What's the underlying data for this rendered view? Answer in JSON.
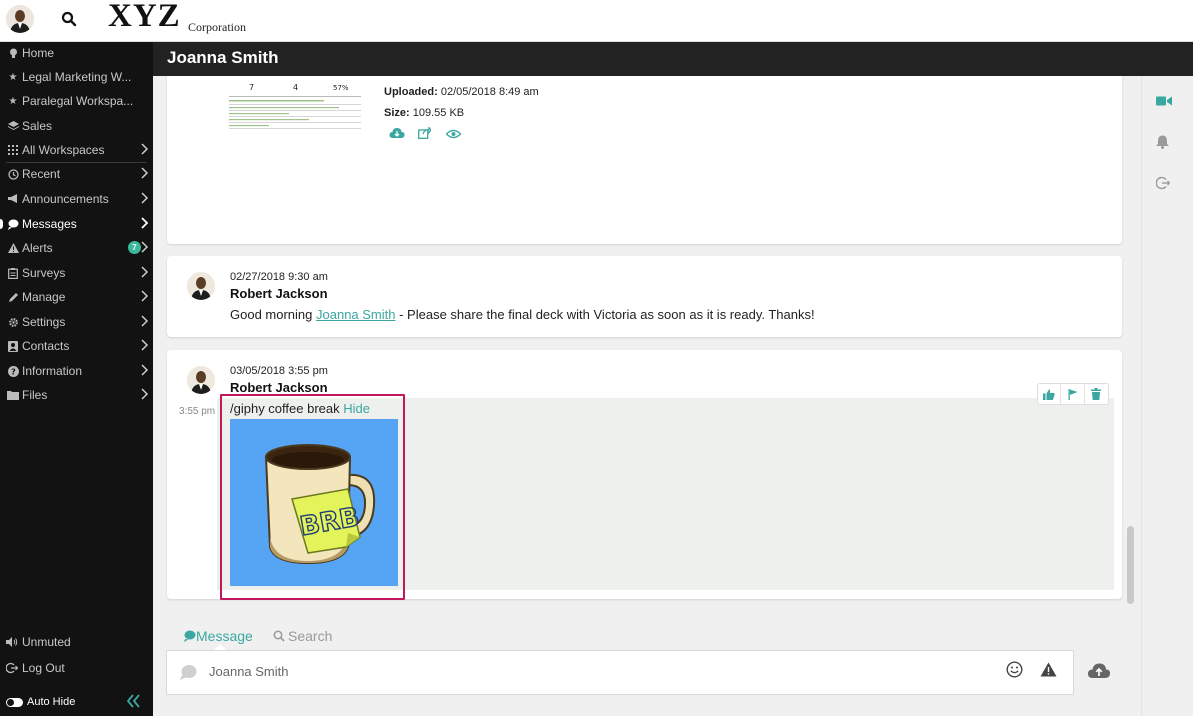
{
  "header": {
    "logo_main": "XYZ",
    "logo_sub": "Corporation"
  },
  "sidebar": {
    "items": [
      {
        "label": "Home",
        "icon": "lightbulb-icon"
      },
      {
        "label": "Legal Marketing W...",
        "icon": "star-icon"
      },
      {
        "label": "Paralegal Workspa...",
        "icon": "star-icon"
      },
      {
        "label": "Sales",
        "icon": "layers-icon"
      },
      {
        "label": "All Workspaces",
        "icon": "grid-icon"
      },
      {
        "label": "Recent",
        "icon": "clock-icon"
      },
      {
        "label": "Announcements",
        "icon": "megaphone-icon"
      },
      {
        "label": "Messages",
        "icon": "chat-icon"
      },
      {
        "label": "Alerts",
        "icon": "warning-icon",
        "badge": "7"
      },
      {
        "label": "Surveys",
        "icon": "clipboard-icon"
      },
      {
        "label": "Manage",
        "icon": "pencil-icon"
      },
      {
        "label": "Settings",
        "icon": "gear-icon"
      },
      {
        "label": "Contacts",
        "icon": "contact-card-icon"
      },
      {
        "label": "Information",
        "icon": "question-icon"
      },
      {
        "label": "Files",
        "icon": "folder-icon"
      }
    ],
    "bottom": {
      "unmuted": "Unmuted",
      "logout": "Log Out",
      "autohide": "Auto Hide"
    }
  },
  "title_bar": {
    "title": "Joanna Smith"
  },
  "file_card": {
    "thumb_values": [
      "7",
      "4",
      "57%"
    ],
    "uploaded_label": "Uploaded:",
    "uploaded_value": "02/05/2018 8:49 am",
    "size_label": "Size:",
    "size_value": "109.55 KB"
  },
  "messages": [
    {
      "time": "02/27/2018 9:30 am",
      "author": "Robert Jackson",
      "text_before": "Good morning ",
      "mention": "Joanna Smith",
      "text_after": " - Please share the final deck with Victoria as soon as it is ready. Thanks!"
    },
    {
      "time": "03/05/2018 3:55 pm",
      "author": "Robert Jackson",
      "side_time": "3:55 pm",
      "command": "/giphy coffee break",
      "hide_label": "Hide",
      "gif_text": "BRB"
    }
  ],
  "composer": {
    "tab_message": "Message",
    "tab_search": "Search",
    "placeholder": "Joanna Smith"
  },
  "colors": {
    "accent": "#3aa7a0",
    "sidebar_bg": "#121212",
    "titlebar_bg": "#222222",
    "highlight": "#c2185b",
    "giphy_bg": "#56a5f5"
  }
}
